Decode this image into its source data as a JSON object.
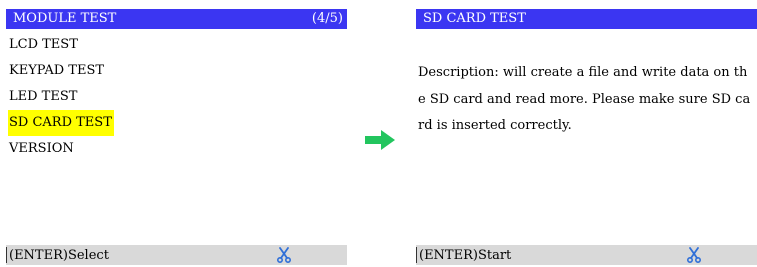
{
  "left_screen": {
    "title": "MODULE TEST",
    "page_indicator": "(4/5)",
    "menu_items": [
      {
        "label": "LCD TEST"
      },
      {
        "label": "KEYPAD TEST"
      },
      {
        "label": "LED TEST"
      },
      {
        "label": "SD CARD TEST"
      },
      {
        "label": "VERSION"
      }
    ],
    "selected_index": 3,
    "footer_hint": "(ENTER)Select",
    "footer_icon": "scissors-icon"
  },
  "transition_icon": "right-arrow-icon",
  "right_screen": {
    "title": "SD CARD TEST",
    "description": "Description: will create a file and write data on the SD card and read more. Please make sure SD card is inserted correctly.",
    "footer_hint": "(ENTER)Start",
    "footer_icon": "scissors-icon"
  },
  "colors": {
    "title_bar": "#3b36f2",
    "highlight": "#ffff00",
    "footer_bar": "#d9d9d9",
    "arrow": "#22c55e",
    "icon": "#2f6fd8"
  }
}
